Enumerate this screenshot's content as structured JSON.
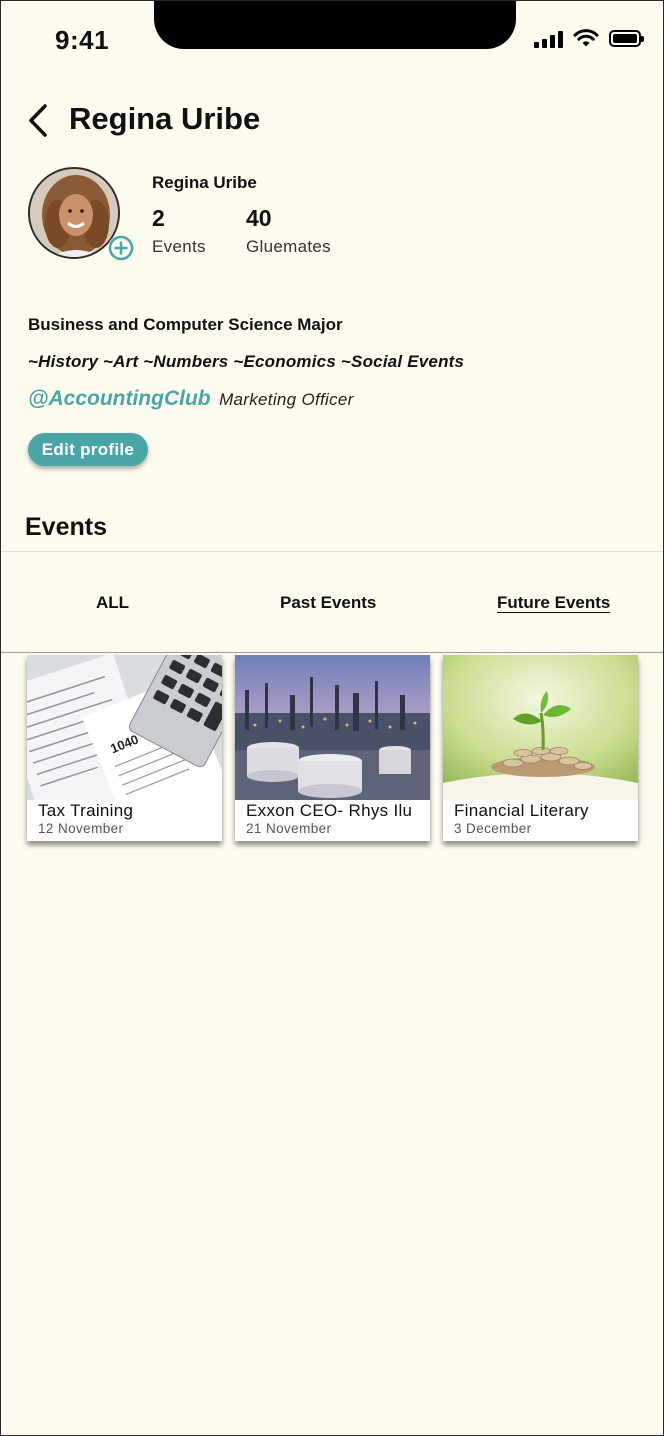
{
  "status_bar": {
    "time": "9:41"
  },
  "header": {
    "title": "Regina Uribe"
  },
  "profile": {
    "name": "Regina Uribe",
    "events_count": "2",
    "events_label": "Events",
    "gluemates_count": "40",
    "gluemates_label": "Gluemates",
    "bio_major": "Business and Computer Science Major",
    "bio_interests": "~History ~Art ~Numbers ~Economics ~Social Events",
    "club_tag": "@AccountingClub",
    "club_role": "Marketing Officer",
    "edit_label": "Edit profile"
  },
  "events_section": {
    "heading": "Events",
    "tabs": [
      {
        "label": "ALL",
        "active": false
      },
      {
        "label": "Past Events",
        "active": false
      },
      {
        "label": "Future Events",
        "active": true
      }
    ],
    "cards": [
      {
        "title": "Tax Training",
        "date": "12 November"
      },
      {
        "title": "Exxon CEO- Rhys Ilu",
        "date": "21 November"
      },
      {
        "title": "Financial Literary",
        "date": "3 December"
      }
    ]
  },
  "colors": {
    "background": "#fdfbef",
    "accent": "#4aa6a6",
    "text": "#111111"
  }
}
